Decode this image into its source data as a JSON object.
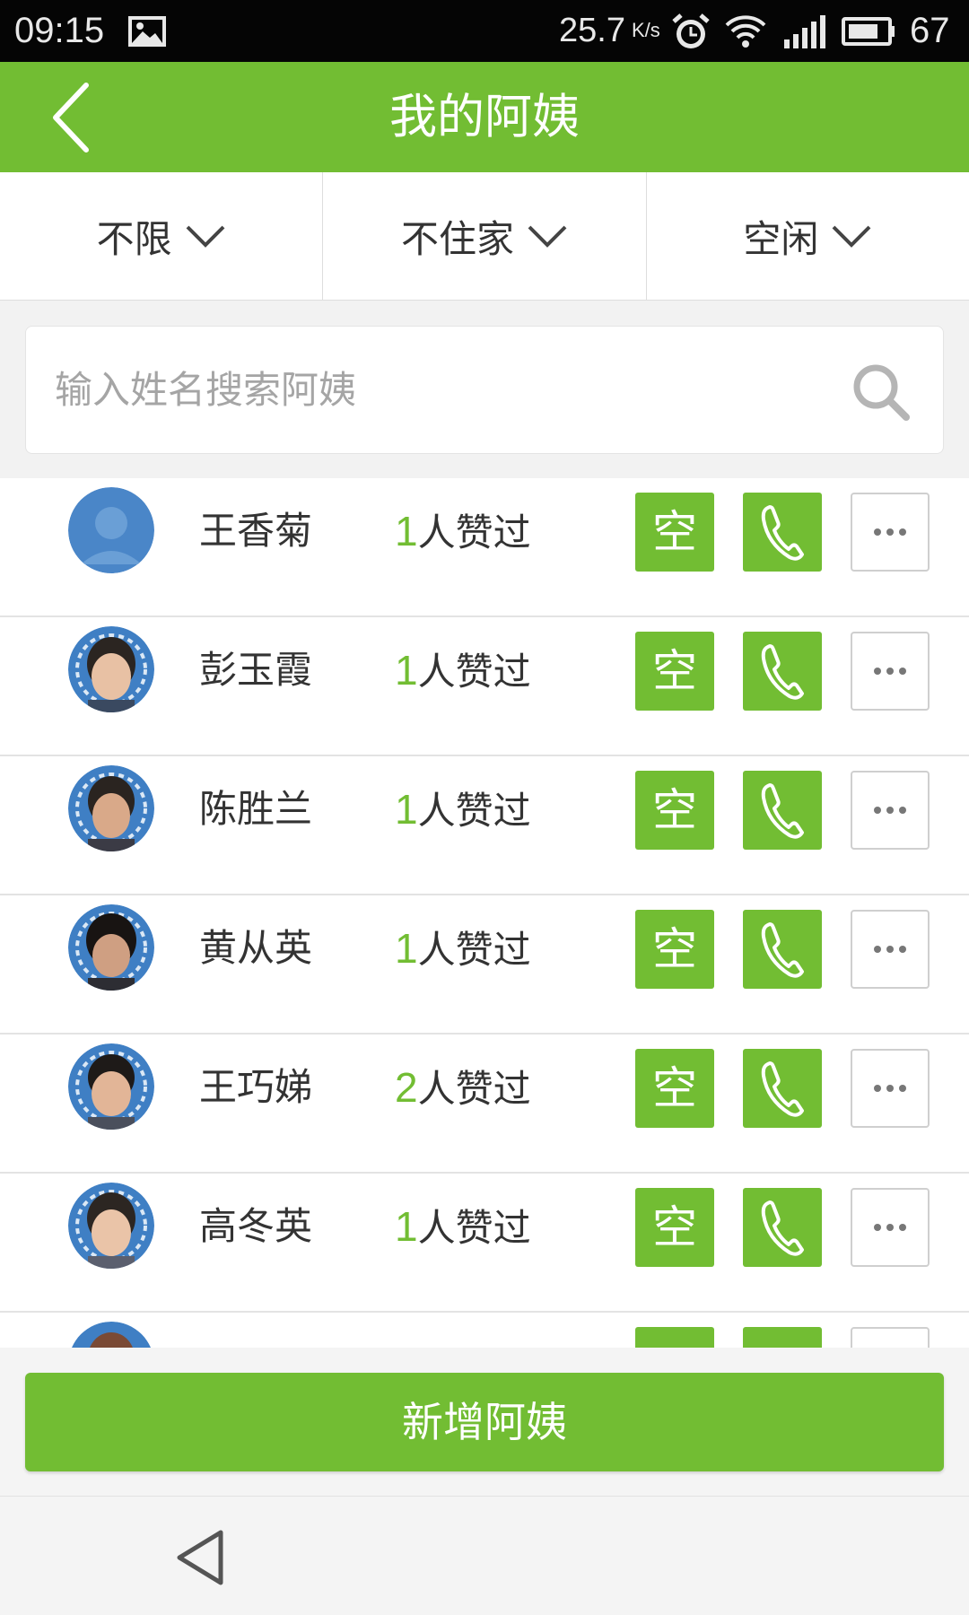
{
  "status_bar": {
    "time": "09:15",
    "speed": "25.7",
    "speed_unit": "K/s",
    "battery": "67"
  },
  "header": {
    "title": "我的阿姨"
  },
  "filters": [
    {
      "label": "不限"
    },
    {
      "label": "不住家"
    },
    {
      "label": "空闲"
    }
  ],
  "search": {
    "placeholder": "输入姓名搜索阿姨",
    "value": ""
  },
  "nannies": [
    {
      "name": "王香菊",
      "likes_count": "1",
      "likes_suffix": "人赞过",
      "status": "空",
      "avatar": "default-avatar"
    },
    {
      "name": "彭玉霞",
      "likes_count": "1",
      "likes_suffix": "人赞过",
      "status": "空",
      "avatar": "photo"
    },
    {
      "name": "陈胜兰",
      "likes_count": "1",
      "likes_suffix": "人赞过",
      "status": "空",
      "avatar": "photo"
    },
    {
      "name": "黄从英",
      "likes_count": "1",
      "likes_suffix": "人赞过",
      "status": "空",
      "avatar": "photo"
    },
    {
      "name": "王巧娣",
      "likes_count": "2",
      "likes_suffix": "人赞过",
      "status": "空",
      "avatar": "photo"
    },
    {
      "name": "高冬英",
      "likes_count": "1",
      "likes_suffix": "人赞过",
      "status": "空",
      "avatar": "photo"
    }
  ],
  "bottom": {
    "add_label": "新增阿姨"
  },
  "colors": {
    "accent": "#72bd33",
    "status_bar": "#050505",
    "text": "#333333",
    "placeholder": "#a5a5a5"
  }
}
